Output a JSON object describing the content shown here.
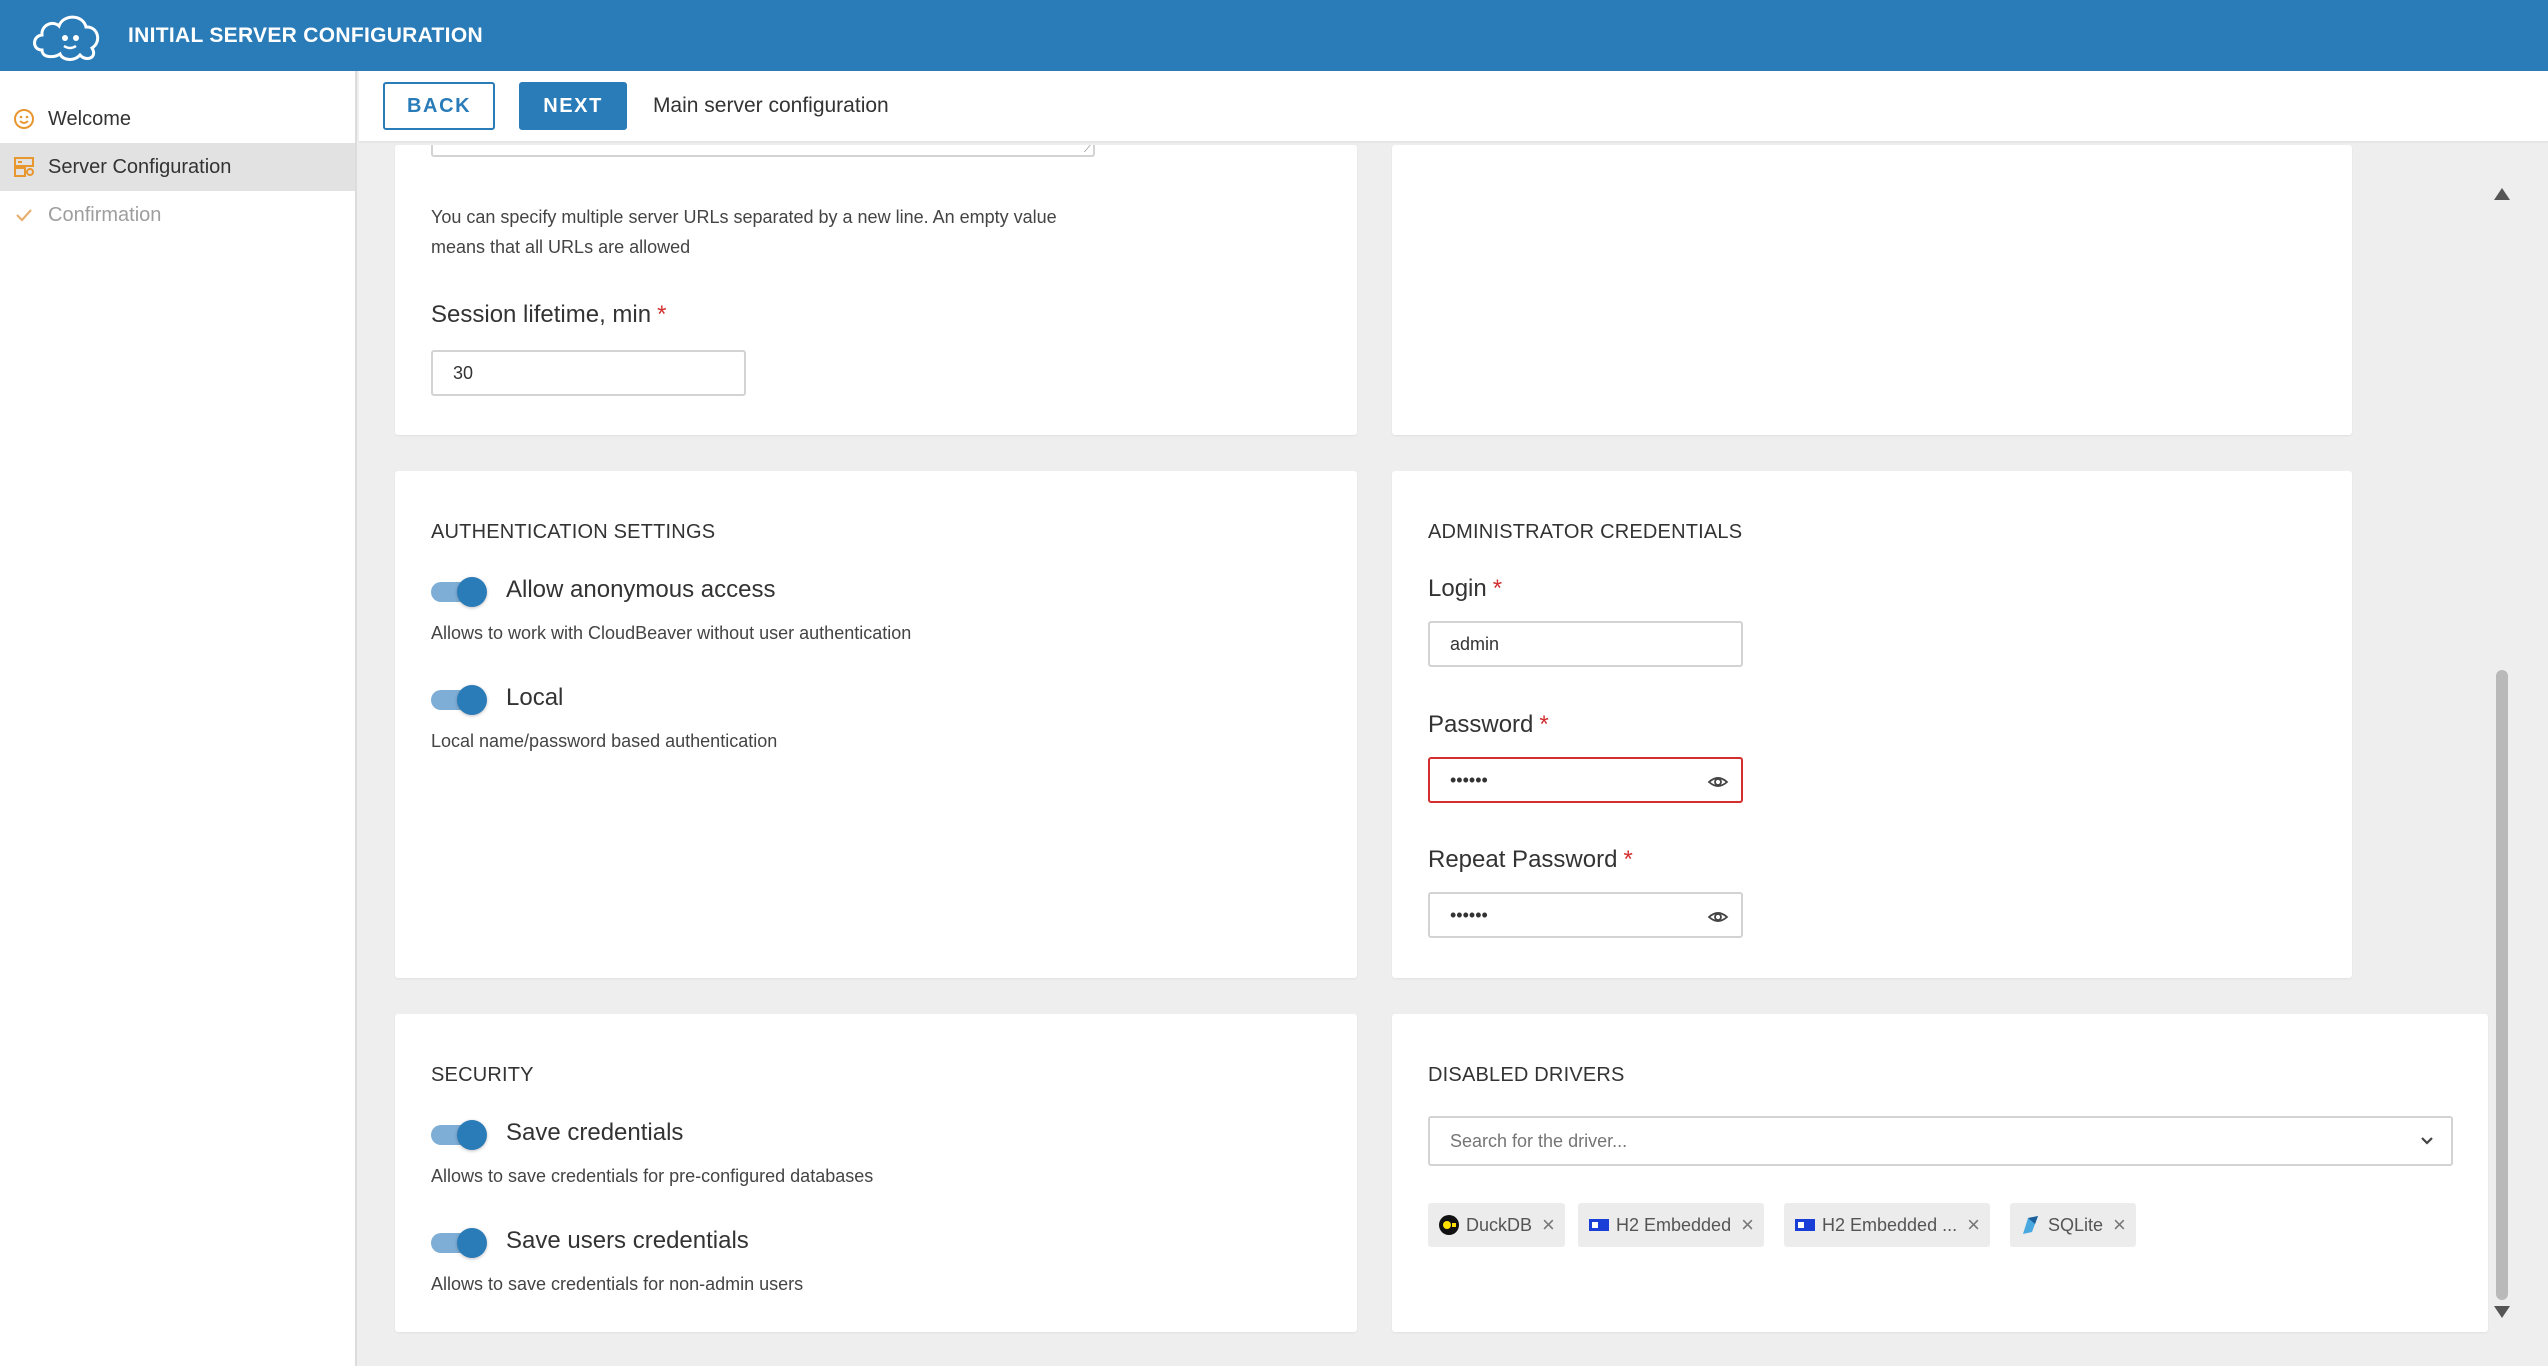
{
  "app": {
    "title": "INITIAL SERVER CONFIGURATION"
  },
  "sidebar": {
    "items": [
      {
        "label": "Welcome",
        "icon": "smile-icon",
        "state": "normal"
      },
      {
        "label": "Server Configuration",
        "icon": "server-config-icon",
        "state": "active"
      },
      {
        "label": "Confirmation",
        "icon": "check-icon",
        "state": "disabled"
      }
    ]
  },
  "toolbar": {
    "back_label": "BACK",
    "next_label": "NEXT",
    "step_title": "Main server configuration"
  },
  "server_settings": {
    "urls_help_line1": "You can specify multiple server URLs separated by a new line. An empty value",
    "urls_help_line2": "means that all URLs are allowed",
    "session_label": "Session lifetime, min",
    "session_value": "30",
    "required_mark": "*"
  },
  "auth": {
    "title": "AUTHENTICATION SETTINGS",
    "anonymous_label": "Allow anonymous access",
    "anonymous_desc": "Allows to work with CloudBeaver without user authentication",
    "local_label": "Local",
    "local_desc": "Local name/password based authentication"
  },
  "admin": {
    "title": "ADMINISTRATOR CREDENTIALS",
    "login_label": "Login",
    "login_value": "admin",
    "password_label": "Password",
    "password_value": "••••••",
    "repeat_label": "Repeat Password",
    "repeat_value": "••••••"
  },
  "security": {
    "title": "SECURITY",
    "save_creds_label": "Save credentials",
    "save_creds_desc": "Allows to save credentials for pre-configured databases",
    "save_users_label": "Save users credentials",
    "save_users_desc": "Allows to save credentials for non-admin users"
  },
  "drivers": {
    "title": "DISABLED DRIVERS",
    "search_placeholder": "Search for the driver...",
    "chips": [
      {
        "label": "DuckDB",
        "icon": "duckdb-icon"
      },
      {
        "label": "H2 Embedded",
        "icon": "h2-icon"
      },
      {
        "label": "H2 Embedded ...",
        "icon": "h2-icon"
      },
      {
        "label": "SQLite",
        "icon": "sqlite-icon"
      }
    ],
    "chip_close": "×"
  },
  "colors": {
    "brand": "#2a7cb9",
    "error": "#d32f2f",
    "accent_icon": "#e8962e"
  }
}
